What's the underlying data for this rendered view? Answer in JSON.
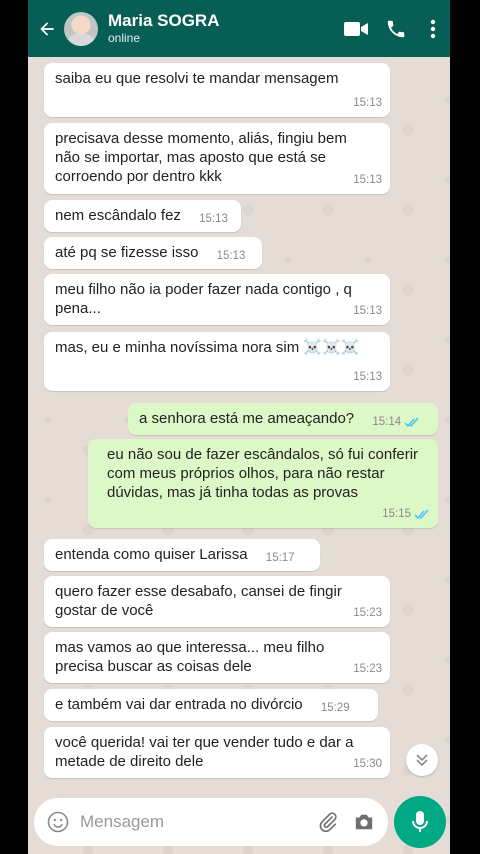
{
  "header": {
    "contact_name": "Maria SOGRA",
    "status": "online"
  },
  "messages": [
    {
      "dir": "in",
      "text": "saiba eu que resolvi te mandar mensagem",
      "time": "15:13"
    },
    {
      "dir": "in",
      "text": "precisava desse momento, aliás, fingiu bem não se importar, mas aposto que está se corroendo por dentro kkk",
      "time": "15:13"
    },
    {
      "dir": "in",
      "text": "nem escândalo fez",
      "time": "15:13"
    },
    {
      "dir": "in",
      "text": "até pq se fizesse isso",
      "time": "15:13"
    },
    {
      "dir": "in",
      "text": "meu filho não ia poder fazer nada contigo , q pena...",
      "time": "15:13"
    },
    {
      "dir": "in",
      "text": "mas, eu e minha novíssima nora sim ☠️☠️☠️",
      "time": "15:13"
    },
    {
      "dir": "out",
      "text": "a senhora está me ameaçando?",
      "time": "15:14"
    },
    {
      "dir": "out",
      "text": "eu não sou de fazer escândalos, só fui conferir com meus próprios olhos, para não restar dúvidas, mas já tinha todas as provas",
      "time": "15:15"
    },
    {
      "dir": "in",
      "text": "entenda como quiser Larissa",
      "time": "15:17"
    },
    {
      "dir": "in",
      "text": "quero fazer esse desabafo, cansei de fingir gostar de você",
      "time": "15:23"
    },
    {
      "dir": "in",
      "text": "mas vamos ao que interessa... meu filho precisa buscar as coisas dele",
      "time": "15:23"
    },
    {
      "dir": "in",
      "text": "e também vai dar entrada no divórcio",
      "time": "15:29"
    },
    {
      "dir": "in",
      "text": "você querida! vai ter que vender tudo e dar a metade de direito dele",
      "time": "15:30"
    }
  ],
  "input": {
    "placeholder": "Mensagem"
  },
  "colors": {
    "header": "#075e54",
    "outgoing_bubble": "#dcf8c6",
    "incoming_bubble": "#ffffff",
    "chat_background": "#e5ddd5",
    "read_ticks": "#4fc3f7",
    "mic_button": "#00a884"
  },
  "icons": {
    "back": "arrow-left",
    "video": "video-camera",
    "call": "phone",
    "menu": "three-dots-vertical",
    "emoji": "smiley",
    "attach": "paperclip",
    "camera": "camera",
    "mic": "microphone",
    "scroll": "chevron-double-down"
  }
}
